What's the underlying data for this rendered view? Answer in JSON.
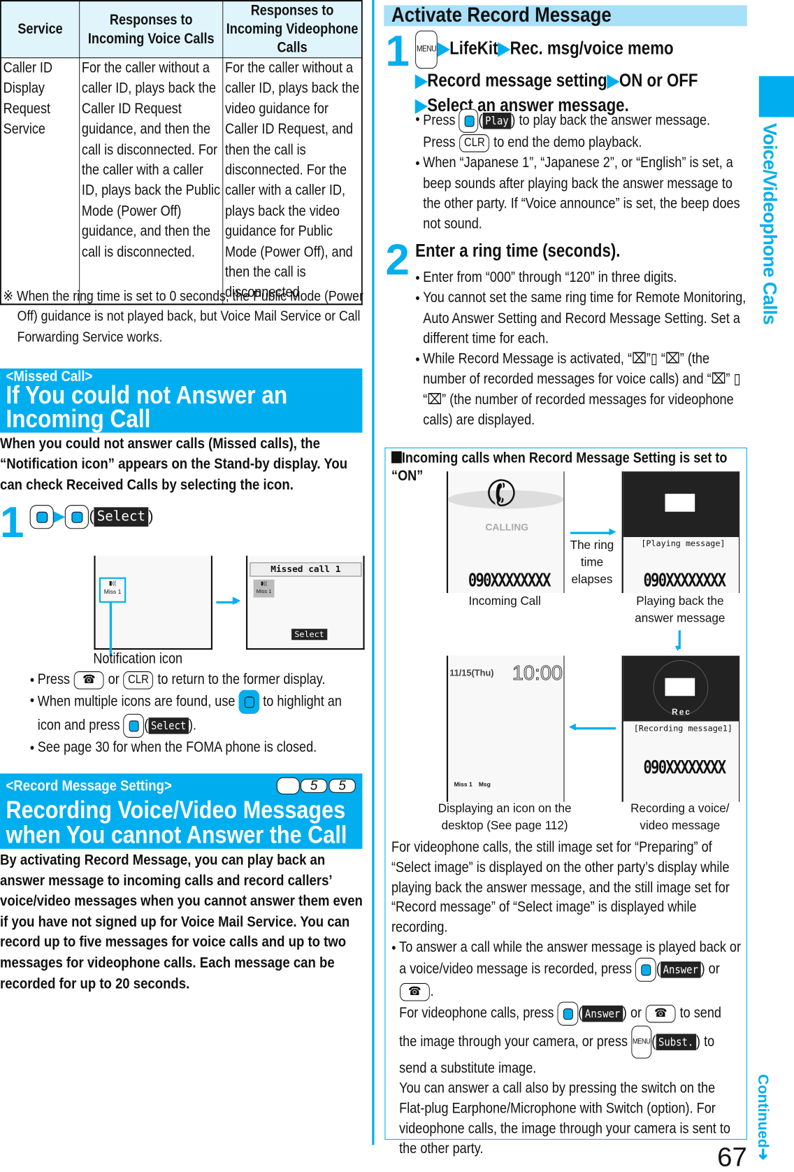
{
  "table": {
    "headers": [
      "Service",
      "Responses to Incoming Voice Calls",
      "Responses to Incoming Videophone Calls"
    ],
    "rows": [
      [
        "Caller ID Display Request Service",
        "For the caller without a caller ID, plays back the Caller ID Request guidance, and then the call is disconnected. For the caller with a caller ID, plays back the Public Mode (Power Off) guidance, and then the call is disconnected.",
        "For the caller without a caller ID, plays back the video guidance for Caller ID Request, and then the call is disconnected. For the caller with a caller ID, plays back the video guidance for Public Mode (Power Off), and then the call is disconnected."
      ]
    ]
  },
  "note": "※ When the ring time is set to 0 seconds, the Public Mode (Power Off) guidance is not played back, but Voice Mail Service or Call Forwarding Service works.",
  "missed": {
    "tag": "<Missed Call>",
    "title": "If You could not Answer an Incoming Call",
    "intro": "When you could not answer calls (Missed calls), the “Notification icon” appears on the Stand-by display. You can check Received Calls by selecting the icon.",
    "step_num": "1",
    "select_label": "Select",
    "screen_missed": "Missed call 1",
    "screen_icon_label": "Miss 1",
    "notification_label": "Notification icon",
    "b1_a": "Press",
    "b1_b": "or",
    "clr": "CLR",
    "b1_c": "to return to the former display.",
    "b2_a": "When multiple icons are found, use",
    "b2_b": "to highlight an icon and press",
    "b2_c": ").",
    "b3": "See page 30 for when the FOMA phone is closed."
  },
  "record": {
    "tag": "<Record Message Setting>",
    "menu": "MENU",
    "k1": "5",
    "k2": "5",
    "title": "Recording Voice/Video Messages when You cannot Answer the Call",
    "intro": "By activating Record Message, you can play back an answer message to incoming calls and record callers’ voice/video messages when you cannot answer them even if you have not signed up for Voice Mail Service. You can record up to five messages for voice calls and up to two messages for videophone calls. Each message can be recorded for up to 20 seconds."
  },
  "activate": {
    "title": "Activate Record Message",
    "step1": {
      "num": "1",
      "menu": "MENU",
      "p1": "LifeKit",
      "p2": "Rec. msg/voice memo",
      "p3": "Record message setting",
      "p4": "ON or OFF",
      "p5": "Select an answer message."
    },
    "b1_a": "Press",
    "play": "Play",
    "b1_b": ") to play back the answer message.",
    "b1_c": "Press",
    "clr": "CLR",
    "b1_d": "to end the demo playback.",
    "b2": "When “Japanese 1”, “Japanese 2”, or “English” is set, a beep sounds after playing back the answer message to the other party. If “Voice announce” is set, the beep does not sound.",
    "step2": {
      "num": "2",
      "title": "Enter a ring time (seconds)."
    },
    "c1": "Enter from “000” through “120” in three digits.",
    "c2": "You cannot set the same ring time for Remote Monitoring, Auto Answer Setting and Record Message Setting. Set a different time for each.",
    "c3_a": "While Record Message is activated, “",
    "c3_b": "”▯ “",
    "c3_c": "” (the number of recorded messages for voice calls) and “",
    "c3_d": "” ▯ “",
    "c3_e": "” (the number of recorded messages for videophone calls) are displayed."
  },
  "box": {
    "title": "Incoming calls when Record Message Setting is set to “ON”",
    "calling": "CALLING",
    "number": "090XXXXXXXX",
    "cap_incoming": "Incoming Call",
    "ring_elapse": "The ring time elapses",
    "playing": "[Playing message]",
    "cap_playing": "Playing back the answer message",
    "date": "11/15(Thu)",
    "time": "10:00",
    "miss": "Miss 1",
    "msg": "Msg",
    "cap_desktop": "Displaying an icon on the desktop (See page 112)",
    "rec": "Rec",
    "recording": "[Recording message1]",
    "cap_recording": "Recording a voice/ video message",
    "p1": "For videophone calls, the still image set for “Preparing” of “Select image” is displayed on the other party’s display while playing back the answer message, and the still image set for “Record message” of “Select image” is displayed while recording.",
    "b_a": "To answer a call while the answer message is played back or a voice/video message is recorded, press",
    "answer": "Answer",
    "or": ") or",
    "dot": ".",
    "b_b": "For videophone calls, press",
    "b_c": "to send the image through your camera, or press",
    "menu": "MENU",
    "subst": "Subst.",
    "b_d": ") to send a substitute image.",
    "b_e": "You can answer a call also by pressing the switch on the Flat-plug Earphone/Microphone with Switch (option). For videophone calls, the image through your camera is sent to the other party."
  },
  "side": {
    "section": "Voice/Videophone Calls",
    "continued": "Continued",
    "page": "67"
  },
  "colors": {
    "accent": "#00aeef",
    "header_bg": "#e0f4fc",
    "title_bar": "#a8e0f8"
  }
}
